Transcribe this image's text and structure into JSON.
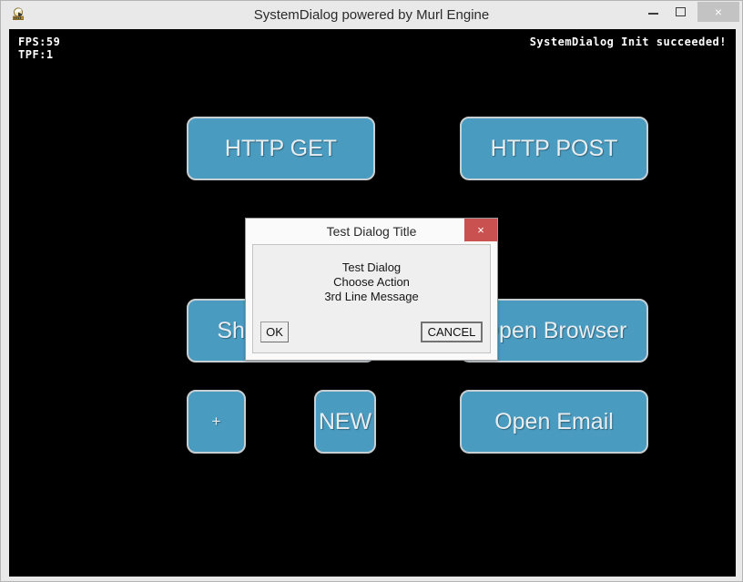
{
  "window": {
    "title": "SystemDialog powered by Murl Engine",
    "icon": "app-icon",
    "caption_buttons": {
      "minimize": "minimize-icon",
      "maximize": "maximize-icon",
      "close": "×"
    }
  },
  "canvas": {
    "background_color": "#000000",
    "hud": {
      "fps": "FPS:59",
      "tpf": "TPF:1",
      "status": "SystemDialog Init succeeded!"
    },
    "button_color": "#4a9bc0",
    "button_border_color": "#c8cfd2",
    "buttons": [
      {
        "id": "http-get",
        "label": "HTTP GET"
      },
      {
        "id": "http-post",
        "label": "HTTP POST"
      },
      {
        "id": "show-dialog",
        "label": "Show Dialog"
      },
      {
        "id": "open-browser",
        "label": "Open Browser"
      },
      {
        "id": "plus",
        "label": "+"
      },
      {
        "id": "new",
        "label": "NEW"
      },
      {
        "id": "open-email",
        "label": "Open Email"
      }
    ]
  },
  "dialog": {
    "title": "Test Dialog Title",
    "close_label": "×",
    "close_color": "#c9514f",
    "message_lines": [
      "Test Dialog",
      "Choose Action",
      "3rd Line Message"
    ],
    "message": "Test Dialog\nChoose Action\n3rd Line Message",
    "ok_label": "OK",
    "cancel_label": "CANCEL"
  }
}
